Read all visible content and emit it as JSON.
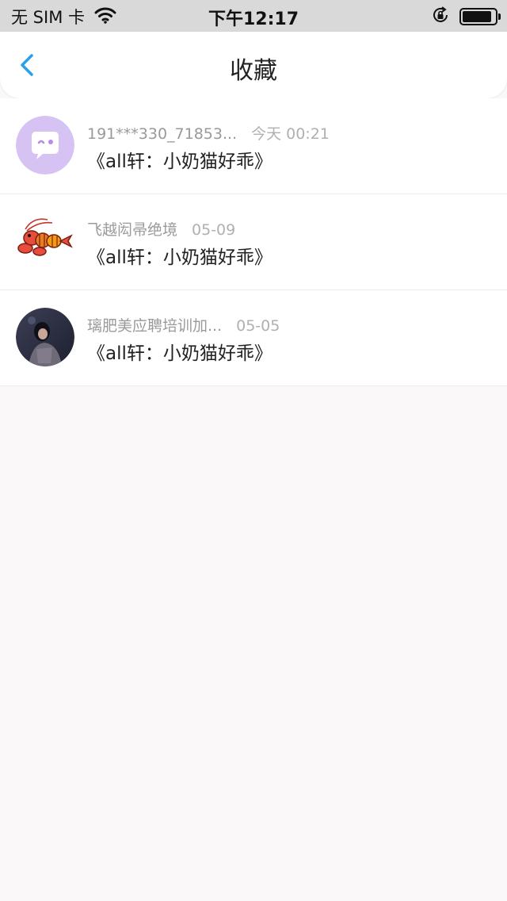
{
  "status": {
    "carrier": "无 SIM 卡",
    "time": "下午12:17"
  },
  "nav": {
    "title": "收藏"
  },
  "items": [
    {
      "name": "191***330_71853...",
      "time": "今天 00:21",
      "message": "《all轩：小奶猫好乖》",
      "avatar": "chat-bubble-avatar"
    },
    {
      "name": "飞越闳帚绝境",
      "time": "05-09",
      "message": "《all轩：小奶猫好乖》",
      "avatar": "lobster-avatar"
    },
    {
      "name": "璃肥美应聘培训加...",
      "time": "05-05",
      "message": "《all轩：小奶猫好乖》",
      "avatar": "photo-avatar"
    }
  ],
  "colors": {
    "accent": "#2aa0e8",
    "page_bg": "#fbf8f9"
  }
}
